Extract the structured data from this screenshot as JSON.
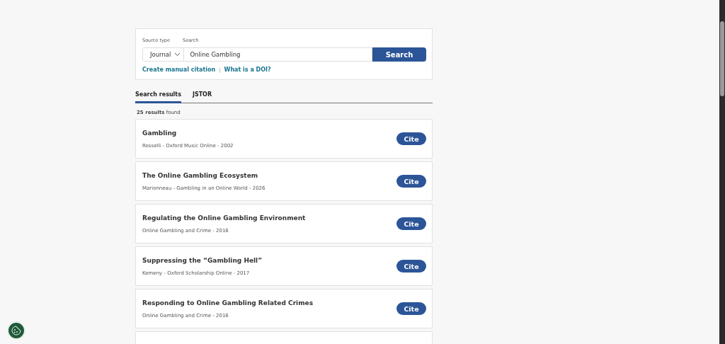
{
  "search_form": {
    "source_type_label": "Source type",
    "search_label": "Search",
    "source_type": "Journal",
    "query": "Online Gambling",
    "button": "Search",
    "links": [
      "Create manual citation",
      "What is a DOI?"
    ],
    "separator": "|"
  },
  "tabs": [
    {
      "label": "Search results",
      "selected": true
    },
    {
      "label": "JSTOR",
      "selected": false
    }
  ],
  "results_count": {
    "count": "25 results",
    "suffix": "found"
  },
  "results": [
    {
      "title": "Gambling",
      "meta": "Rosselli - Oxford Music Online - 2002",
      "button": "Cite"
    },
    {
      "title": "The Online Gambling Ecosystem",
      "meta": "Marionneau - Gambling in an Online World - 2026",
      "button": "Cite"
    },
    {
      "title": "Regulating the Online Gambling Environment",
      "meta": "Online Gambling and Crime - 2016",
      "button": "Cite"
    },
    {
      "title": "Suppressing the “Gambling Hell”",
      "meta": "Kemeny - Oxford Scholarship Online - 2017",
      "button": "Cite"
    },
    {
      "title": "Responding to Online Gambling Related Crimes",
      "meta": "Online Gambling and Crime - 2016",
      "button": "Cite"
    }
  ]
}
